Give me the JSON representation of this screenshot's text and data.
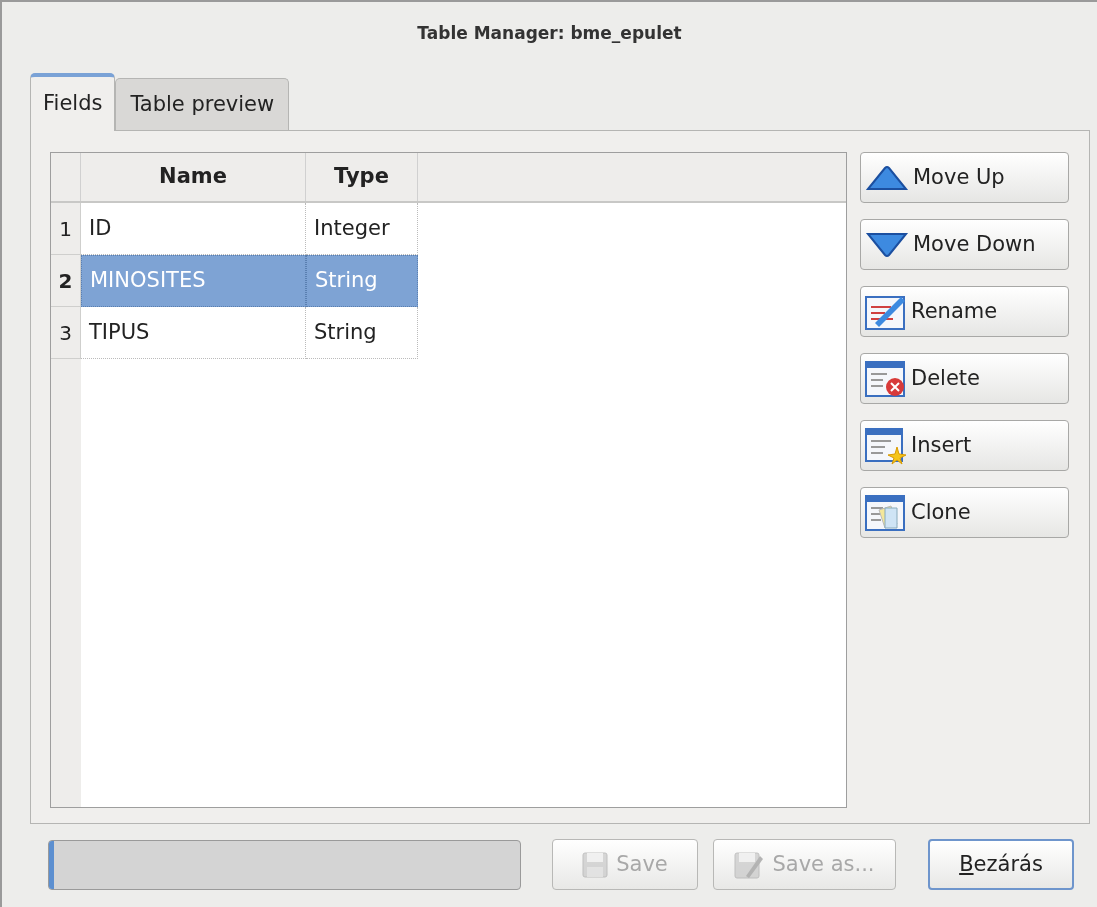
{
  "window": {
    "title": "Table Manager: bme_epulet"
  },
  "tabs": [
    {
      "label": "Fields",
      "selected": true
    },
    {
      "label": "Table preview",
      "selected": false
    }
  ],
  "table": {
    "columns": [
      "Name",
      "Type"
    ],
    "rows": [
      {
        "number": "1",
        "cells": [
          "ID",
          "Integer"
        ],
        "selected": false
      },
      {
        "number": "2",
        "cells": [
          "MINOSITES",
          "String"
        ],
        "selected": true
      },
      {
        "number": "3",
        "cells": [
          "TIPUS",
          "String"
        ],
        "selected": false
      }
    ]
  },
  "side_buttons": [
    {
      "label": "Move Up",
      "kind": "up"
    },
    {
      "label": "Move Down",
      "kind": "down"
    },
    {
      "label": "Rename",
      "kind": "rename"
    },
    {
      "label": "Delete",
      "kind": "delete"
    },
    {
      "label": "Insert",
      "kind": "insert"
    },
    {
      "label": "Clone",
      "kind": "clone"
    }
  ],
  "progress": {
    "level": 0.01
  },
  "bottom_buttons": [
    {
      "label": "Save",
      "kind": "save",
      "disabled": true,
      "default": false
    },
    {
      "label": "Save as...",
      "kind": "saveas",
      "disabled": true,
      "default": false
    },
    {
      "label": "Bezárás",
      "kind": "close",
      "disabled": false,
      "default": true,
      "mnemonic_underlined": true
    }
  ]
}
